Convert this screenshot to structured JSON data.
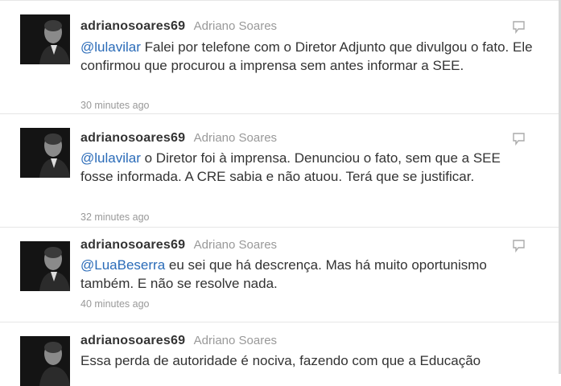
{
  "tweets": [
    {
      "screen_name": "adrianosoares69",
      "full_name": "Adriano Soares",
      "mention": "@lulavilar",
      "text": " Falei por telefone com o Diretor Adjunto que divulgou o fato. Ele confirmou que procurou a imprensa sem antes informar a SEE.",
      "time": "30 minutes ago"
    },
    {
      "screen_name": "adrianosoares69",
      "full_name": "Adriano Soares",
      "mention": "@lulavilar",
      "text": " o Diretor foi à imprensa. Denunciou o fato, sem que a SEE fosse informada. A CRE sabia e não atuou. Terá que se justificar.",
      "time": "32 minutes ago"
    },
    {
      "screen_name": "adrianosoares69",
      "full_name": "Adriano Soares",
      "mention": "@LuaBeserra",
      "text": " eu sei que há descrença. Mas há muito oportunismo também. E não se resolve nada.",
      "time": "40 minutes ago"
    },
    {
      "screen_name": "adrianosoares69",
      "full_name": "Adriano Soares",
      "mention": "",
      "text": "Essa perda de autoridade é nociva, fazendo com que a Educação",
      "time": ""
    }
  ]
}
